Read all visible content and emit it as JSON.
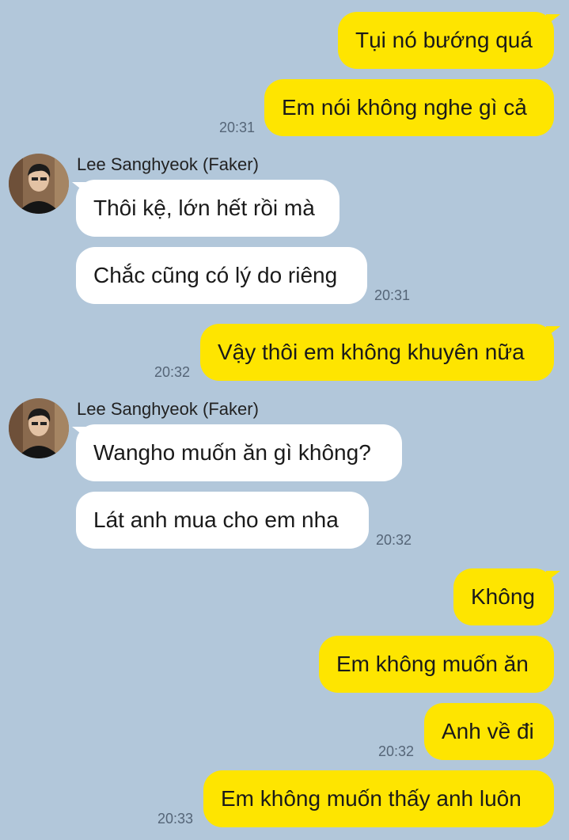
{
  "conversation": {
    "sender_name": "Lee Sanghyeok (Faker)",
    "messages": [
      {
        "side": "out",
        "text": "Tụi nó bướng quá"
      },
      {
        "side": "out",
        "text": "Em nói không nghe gì cả",
        "time": "20:31"
      },
      {
        "side": "in",
        "text": "Thôi kệ, lớn hết rồi mà"
      },
      {
        "side": "in",
        "text": "Chắc cũng có lý do riêng",
        "time": "20:31"
      },
      {
        "side": "out",
        "text": "Vậy thôi em không khuyên nữa",
        "time": "20:32"
      },
      {
        "side": "in",
        "text": "Wangho muốn ăn gì không?"
      },
      {
        "side": "in",
        "text": "Lát anh mua cho em nha",
        "time": "20:32"
      },
      {
        "side": "out",
        "text": "Không"
      },
      {
        "side": "out",
        "text": "Em không muốn ăn"
      },
      {
        "side": "out",
        "text": "Anh về đi",
        "time": "20:32"
      },
      {
        "side": "out",
        "text": "Em không muốn thấy anh luôn",
        "time": "20:33"
      }
    ]
  },
  "icons": {
    "avatar": "profile-photo-avatar"
  },
  "colors": {
    "background": "#b2c7da",
    "outgoing_bubble": "#fee500",
    "incoming_bubble": "#ffffff"
  }
}
